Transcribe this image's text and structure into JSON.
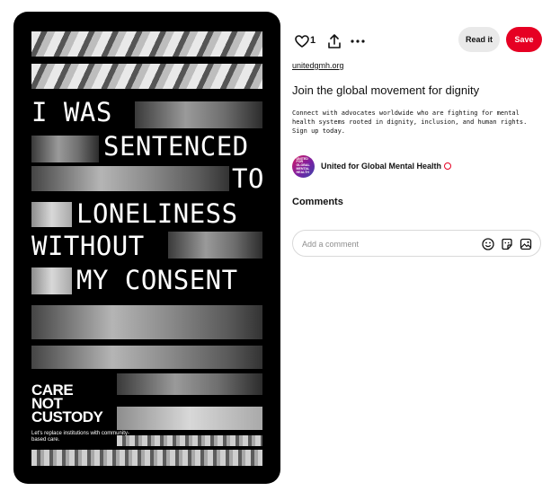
{
  "poster": {
    "lines": [
      "I WAS",
      "SENTENCED",
      "TO",
      "LONELINESS",
      "WITHOUT",
      "MY CONSENT"
    ],
    "brand_lines": [
      "CARE",
      "NOT",
      "CUSTODY"
    ],
    "brand_sub": "Let's replace institutions with community-based care."
  },
  "actions": {
    "like_count": "1",
    "read_label": "Read it",
    "save_label": "Save",
    "icons": [
      "heart-icon",
      "share-icon",
      "more-icon"
    ]
  },
  "pin": {
    "domain": "unitedgmh.org",
    "title": "Join the global movement for dignity",
    "description": "Connect with advocates worldwide who are fighting for mental health systems rooted in dignity, inclusion, and human rights. Sign up today."
  },
  "creator": {
    "avatar_text": "UNITED FOR GLOBAL MENTAL HEALTH",
    "name": "United for Global Mental Health"
  },
  "comments": {
    "heading": "Comments",
    "placeholder": "Add a comment",
    "icons": [
      "emoji-icon",
      "sticker-icon",
      "image-icon"
    ]
  },
  "colors": {
    "save": "#e60023",
    "read_bg": "#e9e9e9",
    "poster_bg": "#000000"
  }
}
